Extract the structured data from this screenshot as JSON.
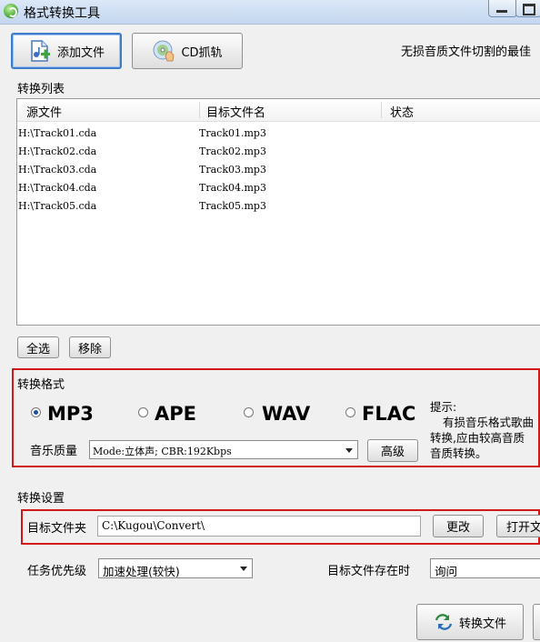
{
  "window": {
    "title": "格式转换工具"
  },
  "toolbar": {
    "add_file_label": "添加文件",
    "cd_rip_label": "CD抓轨",
    "tagline": "无损音质文件切割的最佳"
  },
  "list": {
    "section_label": "转换列表",
    "columns": [
      "源文件",
      "目标文件名",
      "状态"
    ],
    "rows": [
      {
        "source": "H:\\Track01.cda",
        "target": "Track01.mp3",
        "status": ""
      },
      {
        "source": "H:\\Track02.cda",
        "target": "Track02.mp3",
        "status": ""
      },
      {
        "source": "H:\\Track03.cda",
        "target": "Track03.mp3",
        "status": ""
      },
      {
        "source": "H:\\Track04.cda",
        "target": "Track04.mp3",
        "status": ""
      },
      {
        "source": "H:\\Track05.cda",
        "target": "Track05.mp3",
        "status": ""
      }
    ],
    "select_all_label": "全选",
    "remove_label": "移除"
  },
  "format": {
    "section_label": "转换格式",
    "options": [
      "MP3",
      "APE",
      "WAV",
      "FLAC"
    ],
    "selected": "MP3",
    "quality_label": "音乐质量",
    "quality_value": "Mode:立体声; CBR:192Kbps",
    "advanced_label": "高级",
    "tip_title": "提示:",
    "tip_line1": "有损音乐格式歌曲",
    "tip_line2": "转换,应由较高音质",
    "tip_line3": "音质转换。"
  },
  "settings": {
    "section_label": "转换设置",
    "target_folder_label": "目标文件夹",
    "target_folder_value": "C:\\Kugou\\Convert\\",
    "change_label": "更改",
    "open_folder_label": "打开文",
    "priority_label": "任务优先级",
    "priority_value": "加速处理(较快)",
    "exists_label": "目标文件存在时",
    "exists_value": "询问"
  },
  "actions": {
    "convert_label": "转换文件"
  },
  "colors": {
    "highlight_border": "#d21919",
    "titlebar": "#c4d7ef"
  }
}
